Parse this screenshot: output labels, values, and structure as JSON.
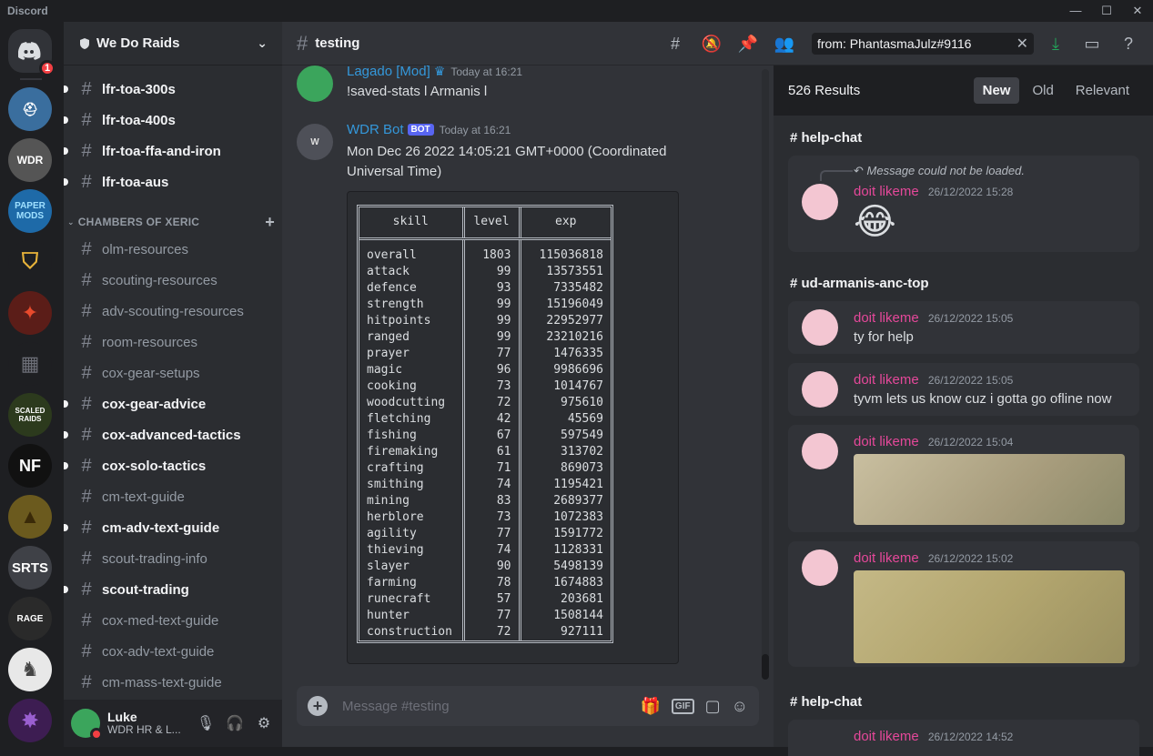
{
  "app": {
    "title": "Discord"
  },
  "server": {
    "name": "We Do Raids",
    "badge_count": "1",
    "guild_labels": [
      "WDR",
      "PAPER MODS",
      "SCALED RAIDS",
      "NF",
      "SRTS",
      "RAGE"
    ]
  },
  "channels": [
    {
      "name": "lfr-toa-300s",
      "unread": true
    },
    {
      "name": "lfr-toa-400s",
      "unread": true
    },
    {
      "name": "lfr-toa-ffa-and-iron",
      "unread": true
    },
    {
      "name": "lfr-toa-aus",
      "unread": true
    }
  ],
  "category": {
    "name": "CHAMBERS OF XERIC"
  },
  "category_channels": [
    {
      "name": "olm-resources",
      "unread": false
    },
    {
      "name": "scouting-resources",
      "unread": false
    },
    {
      "name": "adv-scouting-resources",
      "unread": false
    },
    {
      "name": "room-resources",
      "unread": false
    },
    {
      "name": "cox-gear-setups",
      "unread": false
    },
    {
      "name": "cox-gear-advice",
      "unread": true
    },
    {
      "name": "cox-advanced-tactics",
      "unread": true
    },
    {
      "name": "cox-solo-tactics",
      "unread": true
    },
    {
      "name": "cm-text-guide",
      "unread": false
    },
    {
      "name": "cm-adv-text-guide",
      "unread": true
    },
    {
      "name": "scout-trading-info",
      "unread": false
    },
    {
      "name": "scout-trading",
      "unread": true
    },
    {
      "name": "cox-med-text-guide",
      "unread": false
    },
    {
      "name": "cox-adv-text-guide",
      "unread": false
    },
    {
      "name": "cm-mass-text-guide",
      "unread": false
    }
  ],
  "user": {
    "name": "Luke",
    "status": "WDR HR & L..."
  },
  "header": {
    "channel": "testing",
    "search_value": "from: PhantasmaJulz#9116"
  },
  "messages": [
    {
      "author": "Lagado [Mod]",
      "author_color": "#3498db",
      "timestamp": "Today at 16:21",
      "text": "!saved-stats l Armanis l"
    },
    {
      "author": "WDR Bot",
      "author_color": "#3498db",
      "bot_tag": "BOT",
      "timestamp": "Today at 16:21",
      "text": "Mon Dec 26 2022 14:05:21 GMT+0000 (Coordinated Universal Time)"
    }
  ],
  "stats_table": {
    "headers": [
      "skill",
      "level",
      "exp"
    ],
    "rows": [
      [
        "overall",
        "1803",
        "115036818"
      ],
      [
        "attack",
        "99",
        "13573551"
      ],
      [
        "defence",
        "93",
        "7335482"
      ],
      [
        "strength",
        "99",
        "15196049"
      ],
      [
        "hitpoints",
        "99",
        "22952977"
      ],
      [
        "ranged",
        "99",
        "23210216"
      ],
      [
        "prayer",
        "77",
        "1476335"
      ],
      [
        "magic",
        "96",
        "9986696"
      ],
      [
        "cooking",
        "73",
        "1014767"
      ],
      [
        "woodcutting",
        "72",
        "975610"
      ],
      [
        "fletching",
        "42",
        "45569"
      ],
      [
        "fishing",
        "67",
        "597549"
      ],
      [
        "firemaking",
        "61",
        "313702"
      ],
      [
        "crafting",
        "71",
        "869073"
      ],
      [
        "smithing",
        "74",
        "1195421"
      ],
      [
        "mining",
        "83",
        "2689377"
      ],
      [
        "herblore",
        "73",
        "1072383"
      ],
      [
        "agility",
        "77",
        "1591772"
      ],
      [
        "thieving",
        "74",
        "1128331"
      ],
      [
        "slayer",
        "90",
        "5498139"
      ],
      [
        "farming",
        "78",
        "1674883"
      ],
      [
        "runecraft",
        "57",
        "203681"
      ],
      [
        "hunter",
        "77",
        "1508144"
      ],
      [
        "construction",
        "72",
        "927111"
      ]
    ]
  },
  "composer": {
    "placeholder": "Message #testing",
    "gif_label": "GIF"
  },
  "results": {
    "count": "526 Results",
    "tabs": [
      "New",
      "Old",
      "Relevant"
    ],
    "groups": [
      {
        "channel": "help-chat"
      },
      {
        "channel": "ud-armanis-anc-top"
      },
      {
        "channel": "help-chat"
      }
    ],
    "items": [
      {
        "reply": "Message could not be loaded.",
        "author": "doit likeme",
        "timestamp": "26/12/2022 15:28",
        "text": "😂"
      },
      {
        "author": "doit likeme",
        "timestamp": "26/12/2022 15:05",
        "text": "ty for help"
      },
      {
        "author": "doit likeme",
        "timestamp": "26/12/2022 15:05",
        "text": "tyvm lets us know cuz i gotta go ofline now"
      },
      {
        "author": "doit likeme",
        "timestamp": "26/12/2022 15:04",
        "text": ""
      },
      {
        "author": "doit likeme",
        "timestamp": "26/12/2022 15:02",
        "text": ""
      },
      {
        "author": "doit likeme",
        "timestamp": "26/12/2022 14:52",
        "text": ""
      }
    ]
  },
  "colors": {
    "accent": "#5865f2",
    "mention_pink": "#e5489a",
    "link_blue": "#3498db",
    "download_green": "#23a55a"
  }
}
